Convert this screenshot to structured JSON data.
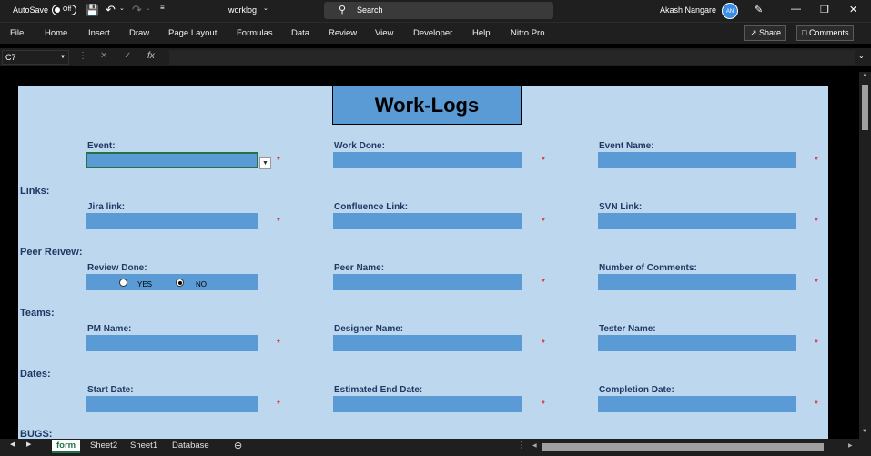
{
  "titlebar": {
    "autosave_label": "AutoSave",
    "autosave_state": "Off",
    "filename": "worklog",
    "search_placeholder": "Search",
    "username": "Akash Nangare",
    "avatar_initials": "AN"
  },
  "menu": [
    "File",
    "Home",
    "Insert",
    "Draw",
    "Page Layout",
    "Formulas",
    "Data",
    "Review",
    "View",
    "Developer",
    "Help",
    "Nitro Pro"
  ],
  "ribbon_right": {
    "share": "Share",
    "comments": "Comments"
  },
  "formula": {
    "namebox": "C7",
    "fx": "fx",
    "value": ""
  },
  "form": {
    "title": "Work-Logs",
    "required_mark": "*",
    "sections": {
      "links": "Links:",
      "peer_review": "Peer Reivew:",
      "teams": "Teams:",
      "dates": "Dates:",
      "bugs": "BUGS:"
    },
    "labels": {
      "event": "Event:",
      "work_done": "Work Done:",
      "event_name": "Event Name:",
      "jira": "Jira link:",
      "confluence": "Confluence Link:",
      "svn": "SVN Link:",
      "review_done": "Review Done:",
      "peer_name": "Peer Name:",
      "num_comments": "Number of Comments:",
      "pm_name": "PM Name:",
      "designer_name": "Designer Name:",
      "tester_name": "Tester Name:",
      "start_date": "Start Date:",
      "est_end_date": "Estimated End Date:",
      "completion_date": "Completion Date:"
    },
    "review_options": {
      "yes": "YES",
      "no": "NO",
      "selected": "NO"
    }
  },
  "tabs": [
    "form",
    "Sheet2",
    "Sheet1",
    "Database"
  ],
  "active_tab": "form",
  "colors": {
    "sheet_bg": "#bdd7ee",
    "field": "#5b9bd5",
    "label": "#1f3864",
    "required": "#e60000",
    "excel_green": "#217346"
  }
}
